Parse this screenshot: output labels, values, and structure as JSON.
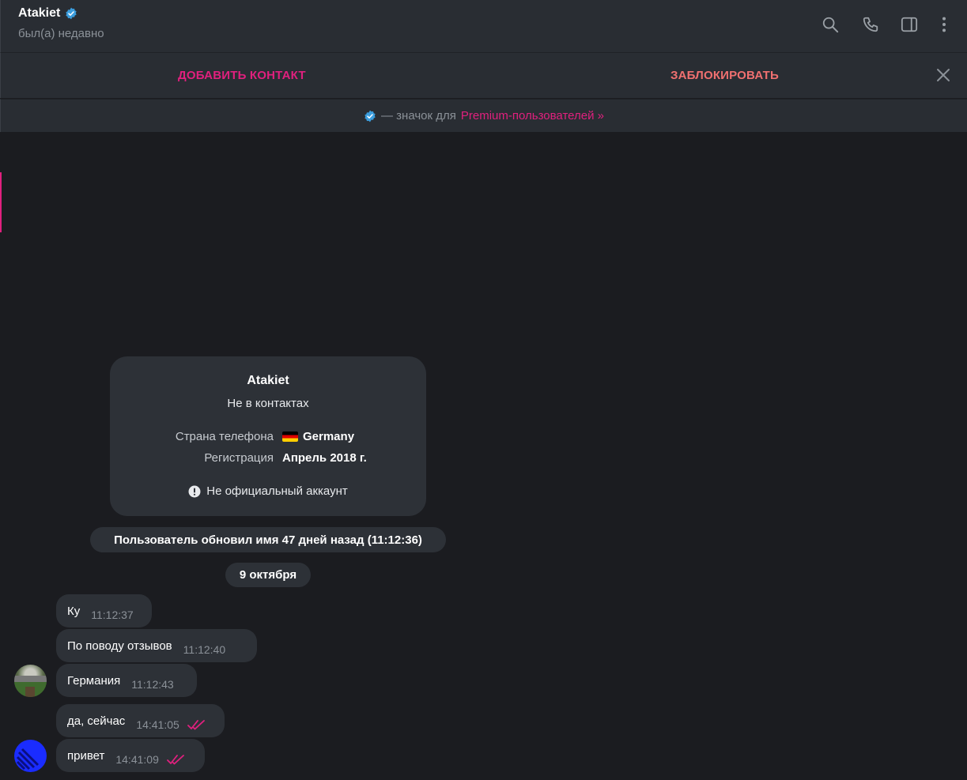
{
  "header": {
    "name": "Atakiet",
    "status": "был(а) недавно"
  },
  "actions": {
    "add_contact": "ДОБАВИТЬ КОНТАКТ",
    "block": "ЗАБЛОКИРОВАТЬ"
  },
  "premium_notice": {
    "text": "— значок для",
    "link": "Premium-пользователей »"
  },
  "info_card": {
    "name": "Atakiet",
    "subtitle": "Не в контактах",
    "phone_country_label": "Страна телефона",
    "phone_country_value": "Germany",
    "registration_label": "Регистрация",
    "registration_value": "Апрель 2018 г.",
    "note": "Не официальный аккаунт"
  },
  "service_message": "Пользователь обновил имя 47 дней назад (11:12:36)",
  "date_divider": "9 октября",
  "messages": [
    {
      "text": "Ку",
      "time": "11:12:37"
    },
    {
      "text": "По поводу отзывов",
      "time": "11:12:40"
    },
    {
      "text": "Германия",
      "time": "11:12:43"
    },
    {
      "text": "да, сейчас",
      "time": "14:41:05"
    },
    {
      "text": "привет",
      "time": "14:41:09"
    }
  ],
  "colors": {
    "accent": "#e0207e",
    "block": "#f07070",
    "verified": "#3b9ddd",
    "bubble": "#2d3137",
    "background": "#1b1c20"
  }
}
